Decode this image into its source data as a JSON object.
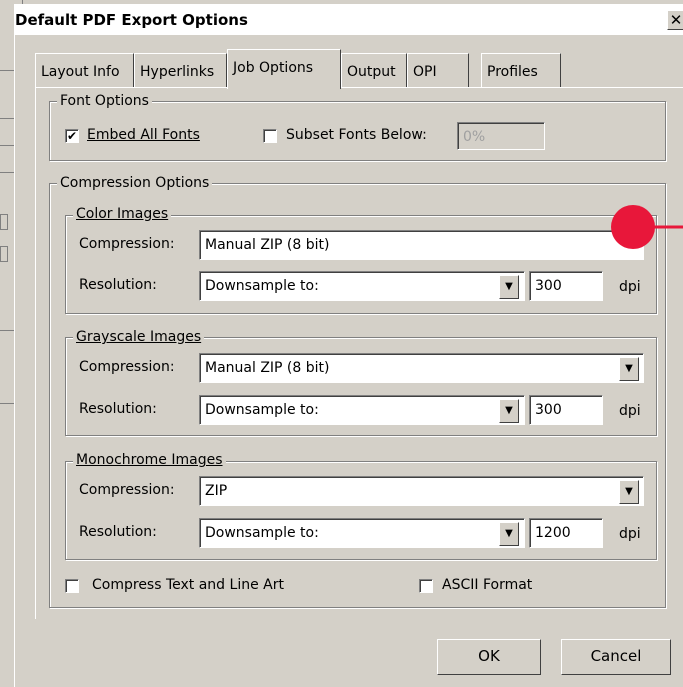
{
  "dialog": {
    "title": "Default PDF Export Options",
    "close_glyph": "✕"
  },
  "tabs": [
    {
      "label": "Layout Info",
      "active": false
    },
    {
      "label": "Hyperlinks",
      "active": false
    },
    {
      "label": "Job Options",
      "active": true
    },
    {
      "label": "Output",
      "active": false
    },
    {
      "label": "OPI",
      "active": false
    },
    {
      "label": "Profiles",
      "active": false
    }
  ],
  "font_options": {
    "legend": "Font Options",
    "embed_all_fonts": {
      "label": "Embed All Fonts",
      "checked": true,
      "mark": "✔"
    },
    "subset_fonts_below": {
      "label": "Subset Fonts Below:",
      "checked": false,
      "value": "0%"
    }
  },
  "compression_options": {
    "legend": "Compression Options",
    "compression_label": "Compression:",
    "resolution_label": "Resolution:",
    "dpi_label": "dpi",
    "arrow_glyph": "▼",
    "color_images": {
      "legend": "Color Images",
      "compression": "Manual ZIP (8 bit)",
      "resolution_mode": "Downsample to:",
      "dpi": "300"
    },
    "grayscale_images": {
      "legend": "Grayscale Images",
      "compression": "Manual ZIP (8 bit)",
      "resolution_mode": "Downsample to:",
      "dpi": "300"
    },
    "monochrome_images": {
      "legend": "Monochrome Images",
      "compression": "ZIP",
      "resolution_mode": "Downsample to:",
      "dpi": "1200"
    },
    "compress_text": {
      "label": "Compress Text and Line Art",
      "checked": false
    },
    "ascii_format": {
      "label": "ASCII Format",
      "checked": false
    }
  },
  "buttons": {
    "ok": "OK",
    "cancel": "Cancel"
  },
  "annotation": {
    "color": "#e8173a"
  }
}
